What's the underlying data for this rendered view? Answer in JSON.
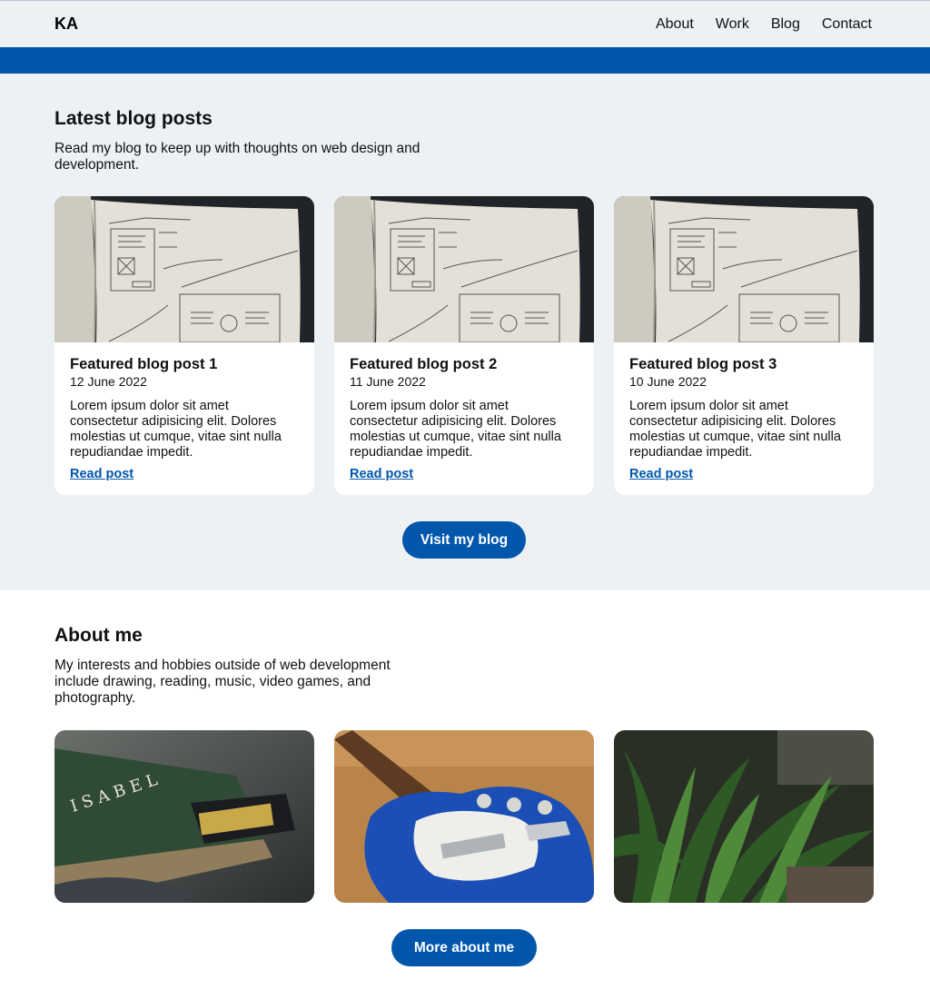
{
  "header": {
    "logo": "KA",
    "nav": [
      {
        "label": "About"
      },
      {
        "label": "Work"
      },
      {
        "label": "Blog"
      },
      {
        "label": "Contact"
      }
    ]
  },
  "blog": {
    "heading": "Latest blog posts",
    "intro": "Read my blog to keep up with thoughts on web design and development.",
    "posts": [
      {
        "title": "Featured blog post 1",
        "date": "12 June 2022",
        "excerpt": "Lorem ipsum dolor sit amet consectetur adipisicing elit. Dolores molestias ut cumque, vitae sint nulla repudiandae impedit.",
        "link": "Read post"
      },
      {
        "title": "Featured blog post 2",
        "date": "11 June 2022",
        "excerpt": "Lorem ipsum dolor sit amet consectetur adipisicing elit. Dolores molestias ut cumque, vitae sint nulla repudiandae impedit.",
        "link": "Read post"
      },
      {
        "title": "Featured blog post 3",
        "date": "10 June 2022",
        "excerpt": "Lorem ipsum dolor sit amet consectetur adipisicing elit. Dolores molestias ut cumque, vitae sint nulla repudiandae impedit.",
        "link": "Read post"
      }
    ],
    "button": "Visit my blog"
  },
  "about": {
    "heading": "About me",
    "intro": "My interests and hobbies outside of web development include drawing, reading, music, video games, and photography.",
    "photos": [
      {
        "icon": "book-photo"
      },
      {
        "icon": "guitar-photo"
      },
      {
        "icon": "plant-photo"
      }
    ],
    "button": "More about me"
  },
  "colors": {
    "accent": "#0257ac",
    "section_bg": "#edf1f4"
  }
}
